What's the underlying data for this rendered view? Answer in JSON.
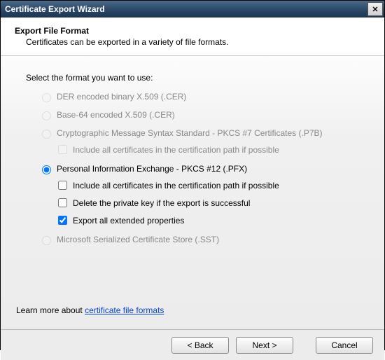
{
  "title": "Certificate Export Wizard",
  "header": {
    "title": "Export File Format",
    "subtitle": "Certificates can be exported in a variety of file formats."
  },
  "prompt": "Select the format you want to use:",
  "options": {
    "der": {
      "label": "DER encoded binary X.509 (.CER)",
      "enabled": false,
      "selected": false
    },
    "base64": {
      "label": "Base-64 encoded X.509 (.CER)",
      "enabled": false,
      "selected": false
    },
    "pkcs7": {
      "label": "Cryptographic Message Syntax Standard - PKCS #7 Certificates (.P7B)",
      "enabled": false,
      "selected": false,
      "sub": {
        "include_chain": {
          "label": "Include all certificates in the certification path if possible",
          "checked": false,
          "enabled": false
        }
      }
    },
    "pfx": {
      "label": "Personal Information Exchange - PKCS #12 (.PFX)",
      "enabled": true,
      "selected": true,
      "sub": {
        "include_chain": {
          "label": "Include all certificates in the certification path if possible",
          "checked": false,
          "enabled": true
        },
        "delete_key": {
          "label": "Delete the private key if the export is successful",
          "checked": false,
          "enabled": true
        },
        "export_ext": {
          "label": "Export all extended properties",
          "checked": true,
          "enabled": true
        }
      }
    },
    "sst": {
      "label": "Microsoft Serialized Certificate Store (.SST)",
      "enabled": false,
      "selected": false
    }
  },
  "learn_more": {
    "prefix": "Learn more about ",
    "link": "certificate file formats"
  },
  "buttons": {
    "back": "< Back",
    "next": "Next >",
    "cancel": "Cancel"
  }
}
